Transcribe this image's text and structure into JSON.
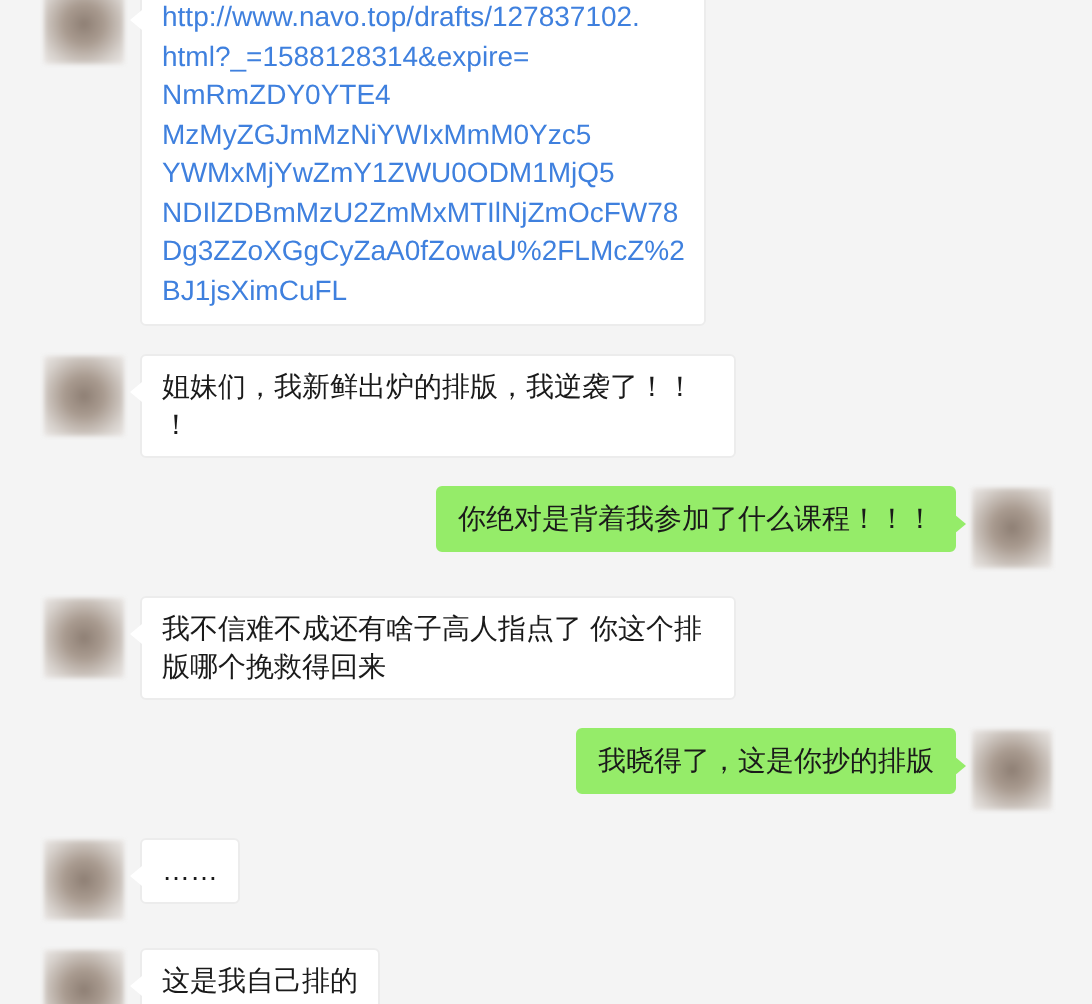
{
  "messages": [
    {
      "outgoing": false,
      "kind": "link",
      "lines": [
        "http://www.navo.top/drafts/127837102.",
        "html?_=1588128314&expire=",
        "NmRmZDY0YTE4",
        "MzMyZGJmMzNiYWIxMmM0Yzc5",
        "YWMxMjYwZmY1ZWU0ODM1MjQ5",
        "NDIlZDBmMzU2ZmMxMTIlNjZmOcFW78",
        "Dg3ZZoXGgCyZaA0fZowaU%2FLMcZ%2",
        "BJ1jsXimCuFL"
      ]
    },
    {
      "outgoing": false,
      "kind": "text",
      "text": "姐妹们，我新鲜出炉的排版，我逆袭了！！！"
    },
    {
      "outgoing": true,
      "kind": "text",
      "text": "你绝对是背着我参加了什么课程！！！"
    },
    {
      "outgoing": false,
      "kind": "text",
      "text": "我不信难不成还有啥子高人指点了 你这个排版哪个挽救得回来"
    },
    {
      "outgoing": true,
      "kind": "text",
      "text": "我晓得了，这是你抄的排版"
    },
    {
      "outgoing": false,
      "kind": "text",
      "text": "……"
    },
    {
      "outgoing": false,
      "kind": "text",
      "text": "这是我自己排的"
    }
  ]
}
